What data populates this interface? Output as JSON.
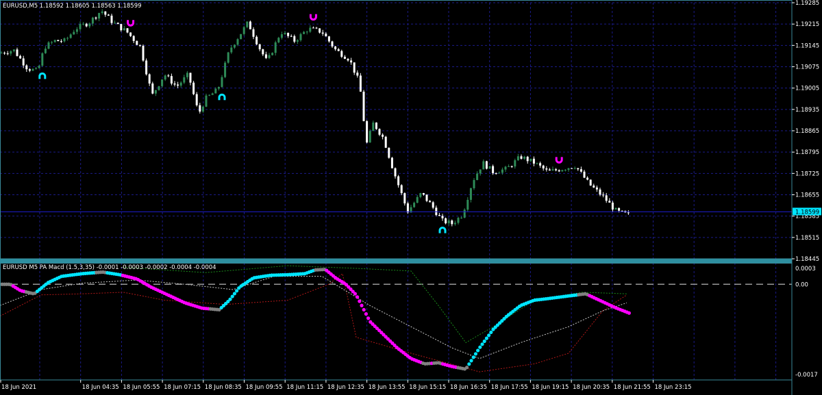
{
  "window": {
    "symbol_header": "EURUSD,M5  1.18592 1.18605 1.18563 1.18599",
    "indicator_header": "EURUSD M5 PA Macd (1.5,3,35) -0.0001 -0.0003 -0.0002 -0.0004 -0.0004"
  },
  "colors": {
    "background": "#000000",
    "grid": "#1b1b8a",
    "bull_candle": "#2e8b57",
    "bear_candle": "#ffffff",
    "price_line": "#1e1ed2",
    "price_tag": "#00e5ff",
    "arrow_up": "#00e5ff",
    "arrow_down": "#ff00ff",
    "macd_up": "#00e5ff",
    "macd_down": "#ff00ff",
    "macd_neutral": "#808080",
    "signal_green": "#1a8c1a",
    "signal_red": "#b01818",
    "signal_white": "#c8c8c8"
  },
  "chart_data": [
    {
      "type": "candlestick",
      "title": "EURUSD,M5",
      "ylim": [
        1.18445,
        1.19285
      ],
      "y_ticks": [
        "1.19285",
        "1.19215",
        "1.19145",
        "1.19075",
        "1.19005",
        "1.18935",
        "1.18865",
        "1.18795",
        "1.18725",
        "1.18655",
        "1.18585",
        "1.18515",
        "1.18445"
      ],
      "current_price": "1.18599",
      "grid": true,
      "price_path": [
        [
          0,
          1.1912
        ],
        [
          20,
          1.1913
        ],
        [
          40,
          1.1907
        ],
        [
          55,
          1.1906
        ],
        [
          65,
          1.1914
        ],
        [
          80,
          1.1916
        ],
        [
          95,
          1.1916
        ],
        [
          110,
          1.192
        ],
        [
          130,
          1.1922
        ],
        [
          148,
          1.1926
        ],
        [
          165,
          1.1922
        ],
        [
          185,
          1.1919
        ],
        [
          205,
          1.1914
        ],
        [
          222,
          1.1898
        ],
        [
          240,
          1.1905
        ],
        [
          258,
          1.1901
        ],
        [
          275,
          1.1905
        ],
        [
          290,
          1.1892
        ],
        [
          300,
          1.1897
        ],
        [
          318,
          1.19
        ],
        [
          335,
          1.1913
        ],
        [
          350,
          1.1918
        ],
        [
          362,
          1.1922
        ],
        [
          378,
          1.1914
        ],
        [
          390,
          1.1909
        ],
        [
          410,
          1.1919
        ],
        [
          430,
          1.1916
        ],
        [
          450,
          1.192
        ],
        [
          470,
          1.1919
        ],
        [
          490,
          1.1913
        ],
        [
          510,
          1.191
        ],
        [
          525,
          1.1902
        ],
        [
          535,
          1.1882
        ],
        [
          545,
          1.1889
        ],
        [
          560,
          1.1884
        ],
        [
          575,
          1.1873
        ],
        [
          595,
          1.186
        ],
        [
          615,
          1.1866
        ],
        [
          630,
          1.1862
        ],
        [
          645,
          1.1857
        ],
        [
          660,
          1.1856
        ],
        [
          675,
          1.1859
        ],
        [
          690,
          1.187
        ],
        [
          705,
          1.1876
        ],
        [
          720,
          1.1873
        ],
        [
          740,
          1.1874
        ],
        [
          760,
          1.1878
        ],
        [
          780,
          1.1876
        ],
        [
          800,
          1.1873
        ],
        [
          820,
          1.1874
        ],
        [
          840,
          1.1875
        ],
        [
          860,
          1.1869
        ],
        [
          880,
          1.1865
        ],
        [
          900,
          1.186
        ],
        [
          915,
          1.1859
        ]
      ],
      "arrows": [
        {
          "kind": "up",
          "index": 13
        },
        {
          "kind": "down",
          "index": 41
        },
        {
          "kind": "up",
          "index": 70
        },
        {
          "kind": "down",
          "index": 99
        },
        {
          "kind": "up",
          "index": 140
        },
        {
          "kind": "down",
          "index": 177
        }
      ]
    },
    {
      "type": "line",
      "title": "EURUSD M5 PA Macd (1.5,3,35)",
      "ylim": [
        -0.0017,
        0.0003
      ],
      "y_ticks": [
        "0.0003",
        "0.00",
        "-0.0017"
      ],
      "zero_line": true,
      "macd_path": [
        [
          0,
          0.0
        ],
        [
          15,
          0.0
        ],
        [
          30,
          -0.00012
        ],
        [
          50,
          -0.00018
        ],
        [
          70,
          3e-05
        ],
        [
          90,
          0.00015
        ],
        [
          120,
          0.0002
        ],
        [
          150,
          0.00023
        ],
        [
          175,
          0.00018
        ],
        [
          200,
          0.0001
        ],
        [
          220,
          -5e-05
        ],
        [
          245,
          -0.0002
        ],
        [
          270,
          -0.00035
        ],
        [
          295,
          -0.00045
        ],
        [
          320,
          -0.00048
        ],
        [
          335,
          -0.0003
        ],
        [
          350,
          -5e-05
        ],
        [
          370,
          0.00012
        ],
        [
          395,
          0.00017
        ],
        [
          420,
          0.00018
        ],
        [
          445,
          0.0002
        ],
        [
          460,
          0.00027
        ],
        [
          475,
          0.00028
        ],
        [
          490,
          0.00012
        ],
        [
          505,
          0.0
        ],
        [
          520,
          -0.0002
        ],
        [
          540,
          -0.0007
        ],
        [
          560,
          -0.00095
        ],
        [
          580,
          -0.0012
        ],
        [
          600,
          -0.0014
        ],
        [
          620,
          -0.0015
        ],
        [
          640,
          -0.00148
        ],
        [
          660,
          -0.00155
        ],
        [
          680,
          -0.0016
        ],
        [
          700,
          -0.0012
        ],
        [
          720,
          -0.00085
        ],
        [
          740,
          -0.0006
        ],
        [
          760,
          -0.0004
        ],
        [
          780,
          -0.0003
        ],
        [
          800,
          -0.00027
        ],
        [
          830,
          -0.00022
        ],
        [
          855,
          -0.00018
        ],
        [
          875,
          -0.0003
        ],
        [
          900,
          -0.00045
        ],
        [
          920,
          -0.00055
        ]
      ],
      "signal_green_path": [
        [
          180,
          0.00032
        ],
        [
          300,
          0.00022
        ],
        [
          420,
          0.00035
        ],
        [
          520,
          0.0003
        ],
        [
          600,
          0.00025
        ],
        [
          640,
          -0.0004
        ],
        [
          680,
          -0.0011
        ],
        [
          720,
          -0.0008
        ],
        [
          780,
          -0.0003
        ],
        [
          850,
          -0.00015
        ],
        [
          915,
          -0.00018
        ]
      ],
      "signal_red_path": [
        [
          0,
          -0.0006
        ],
        [
          60,
          -0.0002
        ],
        [
          120,
          -0.00018
        ],
        [
          180,
          -0.00015
        ],
        [
          240,
          -0.0003
        ],
        [
          330,
          -0.00038
        ],
        [
          420,
          -0.0003
        ],
        [
          480,
          0.0
        ],
        [
          500,
          0.0002
        ],
        [
          520,
          -0.001
        ],
        [
          600,
          -0.0013
        ],
        [
          700,
          -0.00165
        ],
        [
          780,
          -0.0015
        ],
        [
          830,
          -0.0013
        ],
        [
          880,
          -0.0005
        ],
        [
          915,
          -0.0002
        ]
      ],
      "signal_white_path": [
        [
          0,
          -0.0004
        ],
        [
          60,
          -0.0001
        ],
        [
          120,
          2e-05
        ],
        [
          200,
          8e-05
        ],
        [
          270,
          0.0
        ],
        [
          340,
          -0.0001
        ],
        [
          400,
          0.00015
        ],
        [
          470,
          0.00015
        ],
        [
          540,
          -0.0004
        ],
        [
          600,
          -0.0008
        ],
        [
          660,
          -0.0012
        ],
        [
          700,
          -0.0014
        ],
        [
          760,
          -0.0011
        ],
        [
          830,
          -0.0008
        ],
        [
          880,
          -0.0005
        ],
        [
          915,
          -0.00035
        ]
      ]
    }
  ],
  "time_axis": [
    "18 Jun 2021",
    "18 Jun 04:35",
    "18 Jun 05:55",
    "18 Jun 07:15",
    "18 Jun 08:35",
    "18 Jun 09:55",
    "18 Jun 11:15",
    "18 Jun 12:35",
    "18 Jun 13:55",
    "18 Jun 15:15",
    "18 Jun 16:35",
    "18 Jun 17:55",
    "18 Jun 19:15",
    "18 Jun 20:35",
    "18 Jun 21:55",
    "18 Jun 23:15"
  ]
}
